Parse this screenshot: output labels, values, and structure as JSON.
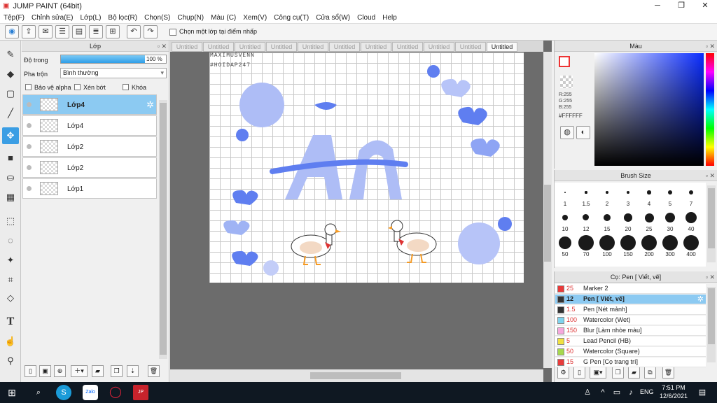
{
  "window": {
    "title": "JUMP PAINT (64bit)",
    "minimize": "─",
    "maximize": "❐",
    "close": "✕"
  },
  "menu": [
    "Tệp(F)",
    "Chỉnh sửa(E)",
    "Lớp(L)",
    "Bộ lọc(R)",
    "Chọn(S)",
    "Chụp(N)",
    "Màu (C)",
    "Xem(V)",
    "Công cụ(T)",
    "Cửa sổ(W)",
    "Cloud",
    "Help"
  ],
  "toolbar": {
    "checkbox_label": "Chọn một lớp tại điểm nhấp"
  },
  "layer_panel": {
    "title": "Lớp",
    "opacity_label": "Độ trong",
    "opacity_value": "100 %",
    "blend_label": "Pha trộn",
    "blend_value": "Bình thường",
    "protect_alpha": "Bảo vệ alpha",
    "clipping": "Xén bớt",
    "lock": "Khóa",
    "layers": [
      {
        "name": "Lớp4",
        "selected": true
      },
      {
        "name": "Lớp4",
        "selected": false
      },
      {
        "name": "Lớp2",
        "selected": false
      },
      {
        "name": "Lớp2",
        "selected": false
      },
      {
        "name": "Lớp1",
        "selected": false
      }
    ]
  },
  "tabs": [
    "Untitled",
    "Untitled",
    "Untitled",
    "Untitled",
    "Untitled",
    "Untitled",
    "Untitled",
    "Untitled",
    "Untitled",
    "Untitled",
    "Untitled"
  ],
  "canvas": {
    "watermark_line1": "MAXIMUSVENN",
    "watermark_line2": "#HOIDAP247",
    "lettering": "Ăn"
  },
  "color_panel": {
    "title": "Màu",
    "r": "R:255",
    "g": "G:255",
    "b": "B:255",
    "hex": "#FFFFFF"
  },
  "brush_panel": {
    "title": "Brush Size",
    "sizes": [
      "1",
      "1.5",
      "2",
      "3",
      "4",
      "5",
      "7",
      "10",
      "12",
      "15",
      "20",
      "25",
      "30",
      "40",
      "50",
      "70",
      "100",
      "150",
      "200",
      "300",
      "400"
    ]
  },
  "pen_panel": {
    "title": "Cọ: Pen [ Viết, vẽ]",
    "items": [
      {
        "size": "25",
        "name": "Marker 2",
        "color": "#e83a3a",
        "selected": false
      },
      {
        "size": "12",
        "name": "Pen [ Viết, vẽ]",
        "color": "#333333",
        "selected": true
      },
      {
        "size": "1.5",
        "name": "Pen [Nét mảnh]",
        "color": "#333333",
        "selected": false
      },
      {
        "size": "100",
        "name": "Watercolor (Wet)",
        "color": "#7fd3ee",
        "selected": false
      },
      {
        "size": "150",
        "name": "Blur [Làm nhòe màu]",
        "color": "#f7a8dd",
        "selected": false
      },
      {
        "size": "5",
        "name": "Lead Pencil (HB)",
        "color": "#f0e040",
        "selected": false
      },
      {
        "size": "50",
        "name": "Watercolor (Square)",
        "color": "#a6d84e",
        "selected": false
      },
      {
        "size": "15",
        "name": "G Pen [Cọ trang trí]",
        "color": "#e83a3a",
        "selected": false
      }
    ]
  },
  "taskbar": {
    "time": "7:51 PM",
    "date": "12/6/2021",
    "lang": "ENG"
  }
}
